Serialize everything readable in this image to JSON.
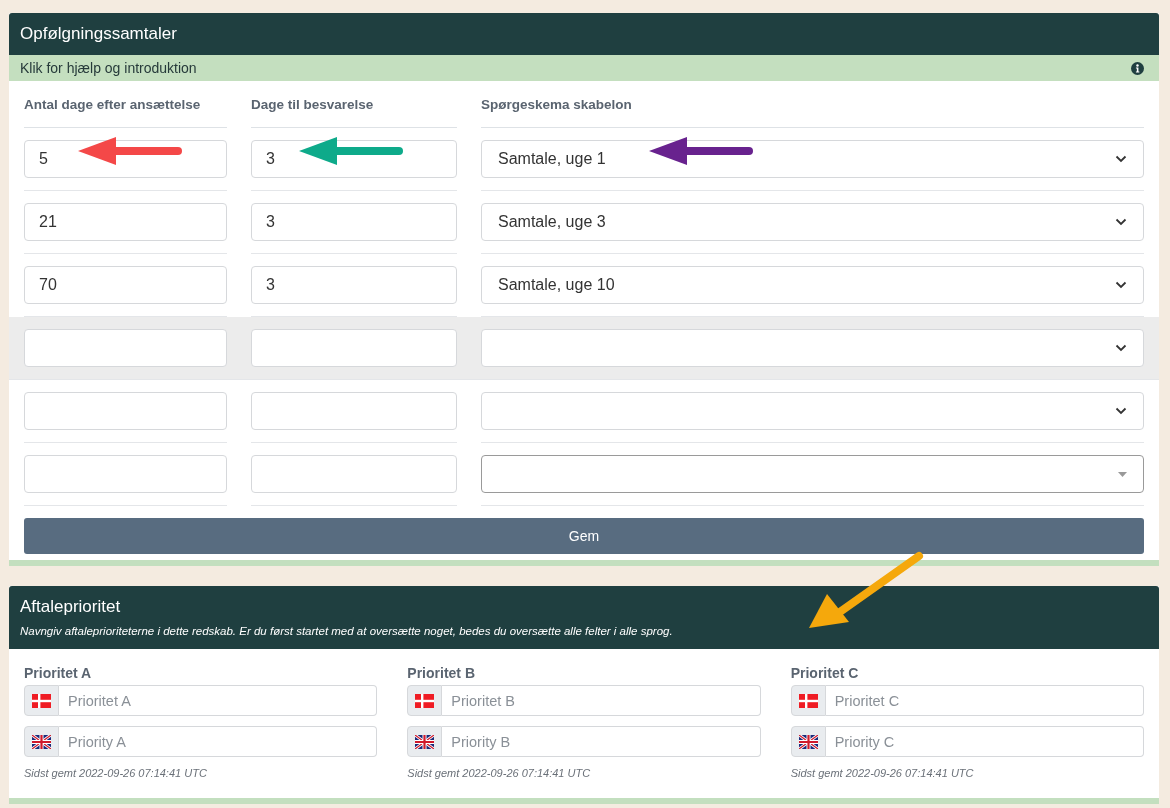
{
  "followup_panel": {
    "title": "Opfølgningssamtaler",
    "help_link": "Klik for hjælp og introduktion",
    "columns": [
      "Antal dage efter ansættelse",
      "Dage til besvarelse",
      "Spørgeskema skabelon"
    ],
    "rows": [
      {
        "days": "5",
        "answer_days": "3",
        "template": "Samtale, uge 1",
        "highlighted": false,
        "searchable": false,
        "arrows": [
          {
            "color": "#f44848"
          },
          {
            "color": "#0eaa8a"
          },
          {
            "color": "#68228e"
          }
        ]
      },
      {
        "days": "21",
        "answer_days": "3",
        "template": "Samtale, uge 3",
        "highlighted": false,
        "searchable": false
      },
      {
        "days": "70",
        "answer_days": "3",
        "template": "Samtale, uge 10",
        "highlighted": false,
        "searchable": false
      },
      {
        "days": "",
        "answer_days": "",
        "template": "",
        "highlighted": true,
        "searchable": false
      },
      {
        "days": "",
        "answer_days": "",
        "template": "",
        "highlighted": false,
        "searchable": false
      },
      {
        "days": "",
        "answer_days": "",
        "template": "",
        "highlighted": false,
        "searchable": true
      }
    ],
    "save_button": "Gem"
  },
  "priority_panel": {
    "title": "Aftaleprioritet",
    "description": "Navngiv aftaleprioriteterne i dette redskab. Er du først startet med at oversætte noget, bedes du oversætte alle felter i alle sprog.",
    "arrows": [
      {
        "color": "#f5a80c"
      }
    ],
    "priorities": [
      {
        "label": "Prioritet A",
        "fields": [
          {
            "kind": "danish",
            "placeholder": "Prioritet A"
          },
          {
            "kind": "english",
            "placeholder": "Priority A"
          }
        ],
        "saved": "Sidst gemt 2022-09-26 07:14:41 UTC"
      },
      {
        "label": "Prioritet B",
        "fields": [
          {
            "kind": "danish",
            "placeholder": "Prioritet B"
          },
          {
            "kind": "english",
            "placeholder": "Priority B"
          }
        ],
        "saved": "Sidst gemt 2022-09-26 07:14:41 UTC"
      },
      {
        "label": "Prioritet C",
        "fields": [
          {
            "kind": "danish",
            "placeholder": "Prioritet C"
          },
          {
            "kind": "english",
            "placeholder": "Priority C"
          }
        ],
        "saved": "Sidst gemt 2022-09-26 07:14:41 UTC"
      }
    ]
  }
}
